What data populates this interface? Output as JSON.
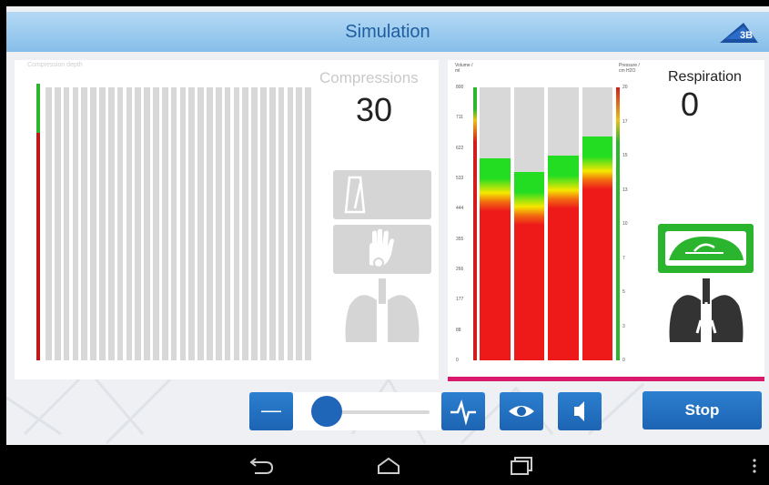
{
  "window": {
    "title": "Simulation"
  },
  "compressions": {
    "label": "Compressions",
    "count": "30",
    "faint_header": "Compression depth",
    "bar_count": 30,
    "depth_meter_fill": 0.82,
    "colors": {
      "bar": "#d8d8d8",
      "good": "#2db52d",
      "bad": "#c01818"
    }
  },
  "respiration": {
    "label": "Respiration",
    "count": "0",
    "volume_axis_title": [
      "Volume /",
      "ml"
    ],
    "pressure_axis_title": [
      "Pressure /",
      "cm H2O"
    ],
    "volume_ticks": [
      "800",
      "711",
      "622",
      "533",
      "444",
      "355",
      "266",
      "177",
      "88",
      "0"
    ],
    "pressure_ticks": [
      "20",
      "17",
      "15",
      "13",
      "10",
      "7",
      "5",
      "3",
      "0"
    ],
    "breath_bar_levels": [
      0.74,
      0.69,
      0.75,
      0.82
    ],
    "colors": {
      "accent": "#d9196b",
      "green": "#22dd22",
      "red": "#ee1a1a",
      "yellow": "#f5e800"
    }
  },
  "icons": {
    "left": [
      "metronome-icon",
      "hand-icon",
      "lungs-icon"
    ],
    "right": [
      "airway-icon",
      "lungs-icon"
    ]
  },
  "controls": {
    "minus_label": "—",
    "slider_value": 0.1,
    "stop_label": "Stop"
  },
  "navbar": [
    "back-icon",
    "home-icon",
    "recent-apps-icon",
    "overflow-menu-icon"
  ]
}
